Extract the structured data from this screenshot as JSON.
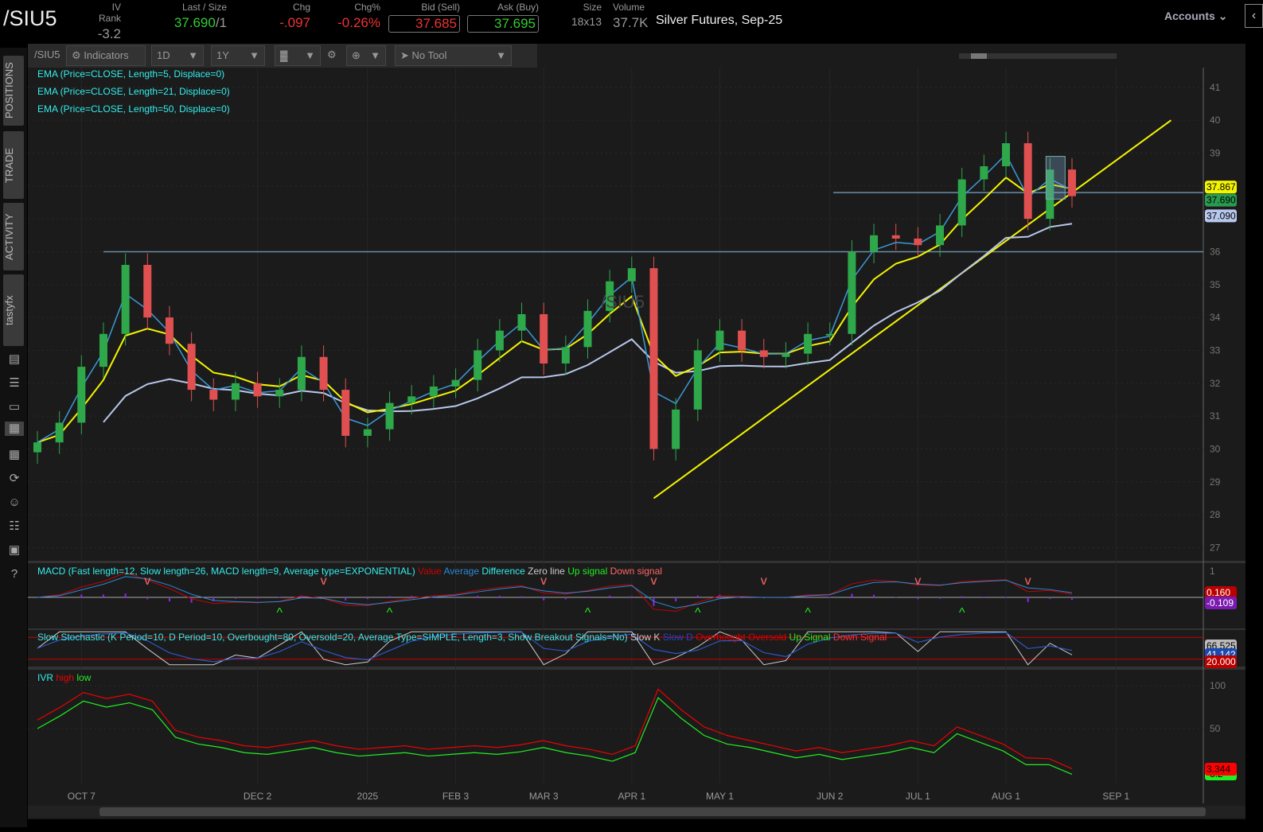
{
  "header": {
    "symbol": "/SIU5",
    "iv_rank_label": "IV Rank",
    "iv_rank": "-3.2",
    "last_label": "Last / Size",
    "last": "37.690",
    "size_sep": "/1",
    "chg_label": "Chg",
    "chg": "-.097",
    "chgpct_label": "Chg%",
    "chgpct": "-0.26%",
    "bid_label": "Bid (Sell)",
    "bid": "37.685",
    "ask_label": "Ask (Buy)",
    "ask": "37.695",
    "size_label": "Size",
    "size": "18x13",
    "volume_label": "Volume",
    "volume": "37.7K",
    "description": "Silver Futures, Sep-25",
    "accounts": "Accounts"
  },
  "rail": {
    "tabs": [
      "POSITIONS",
      "TRADE",
      "ACTIVITY",
      "tastyfx"
    ],
    "icons": [
      "chart-icon",
      "list-icon",
      "tv-icon",
      "grid-chart-icon",
      "tiles-icon",
      "history-icon",
      "people-icon",
      "calendar-icon",
      "fx-icon",
      "help-icon"
    ]
  },
  "toolbar": {
    "symbol": "/SIU5",
    "indicators": "Indicators",
    "aggregation": "1D",
    "range": "1Y",
    "tool": "No Tool"
  },
  "studies": [
    "EMA (Price=CLOSE, Length=5, Displace=0)",
    "EMA (Price=CLOSE, Length=21, Displace=0)",
    "EMA (Price=CLOSE, Length=50, Displace=0)"
  ],
  "watermark": "/SIU5",
  "macd": {
    "title": "MACD (Fast length=12, Slow length=26, MACD length=9, Average type=EXPONENTIAL)",
    "legend": [
      "Value",
      "Average",
      "Difference",
      "Zero line",
      "Up signal",
      "Down signal"
    ],
    "axis": "1",
    "value_tag": "0.160",
    "avg_tag": "-0.109"
  },
  "stoch": {
    "title": "Slow Stochastic (K Period=10, D Period=10, Overbought=80, Oversold=20, Average Type=SIMPLE, Length=3, Show Breakout Signals=No)",
    "legend": [
      "Slow K",
      "Slow D",
      "Overbought",
      "Oversold",
      "Up Signal",
      "Down Signal"
    ],
    "k_tag": "66.525",
    "d_tag": "41.142",
    "os_tag": "20.000"
  },
  "ivr": {
    "title": "IVR",
    "legend": [
      "high",
      "low"
    ],
    "high_tag": "3.344",
    "low_tag": "-3.2"
  },
  "price_tags": {
    "ema5": "37.867",
    "last": "37.690",
    "ema50": "37.090"
  },
  "colors": {
    "up": "#2ea84a",
    "down": "#e05050",
    "ema5": "#3a9ad8",
    "ema21": "#f4f400",
    "ema50": "#b8c8ec",
    "trend": "#f4f400"
  },
  "chart_data": {
    "type": "candlestick",
    "y_ticks": [
      27,
      28,
      29,
      30,
      31,
      32,
      33,
      34,
      35,
      36,
      37,
      38,
      39,
      40,
      41
    ],
    "ylim": [
      26.6,
      41.6
    ],
    "x_labels": [
      {
        "label": "OCT 7",
        "i": 2
      },
      {
        "label": "DEC 2",
        "i": 10
      },
      {
        "label": "2025",
        "i": 15
      },
      {
        "label": "FEB 3",
        "i": 19
      },
      {
        "label": "MAR 3",
        "i": 23
      },
      {
        "label": "APR 1",
        "i": 27
      },
      {
        "label": "MAY 1",
        "i": 31
      },
      {
        "label": "JUN 2",
        "i": 36
      },
      {
        "label": "JUL 1",
        "i": 40
      },
      {
        "label": "AUG 1",
        "i": 44
      },
      {
        "label": "SEP 1",
        "i": 49
      }
    ],
    "closes": [
      30.2,
      30.8,
      32.5,
      33.5,
      35.6,
      34.0,
      33.2,
      31.8,
      31.5,
      32.0,
      31.6,
      31.8,
      32.8,
      31.8,
      30.4,
      30.6,
      31.4,
      31.6,
      31.9,
      32.1,
      33.0,
      33.6,
      34.1,
      32.6,
      33.1,
      34.2,
      35.1,
      35.5,
      30.0,
      31.2,
      33.0,
      33.6,
      33.0,
      32.8,
      32.9,
      33.5,
      33.5,
      36.0,
      36.5,
      36.4,
      36.2,
      36.8,
      38.2,
      38.6,
      39.3,
      37.0,
      38.5,
      37.69
    ],
    "support_levels": [
      36.0,
      37.8
    ],
    "trendline": {
      "from": {
        "i": 28,
        "price": 28.5
      },
      "to": {
        "i": 51.5,
        "price": 40.0
      }
    },
    "ivr_high": [
      60,
      75,
      92,
      85,
      90,
      82,
      48,
      40,
      36,
      30,
      28,
      32,
      36,
      30,
      26,
      28,
      30,
      26,
      28,
      30,
      28,
      31,
      36,
      30,
      26,
      20,
      30,
      96,
      72,
      52,
      42,
      36,
      30,
      24,
      28,
      22,
      26,
      30,
      36,
      30,
      52,
      42,
      32,
      16,
      15,
      3.3
    ],
    "ivr_low": [
      50,
      65,
      82,
      75,
      80,
      72,
      40,
      32,
      28,
      22,
      20,
      24,
      28,
      22,
      18,
      20,
      22,
      18,
      20,
      22,
      20,
      23,
      28,
      22,
      18,
      12,
      22,
      86,
      62,
      42,
      32,
      28,
      22,
      16,
      20,
      14,
      18,
      22,
      28,
      22,
      44,
      34,
      24,
      8,
      8,
      -3.2
    ]
  }
}
